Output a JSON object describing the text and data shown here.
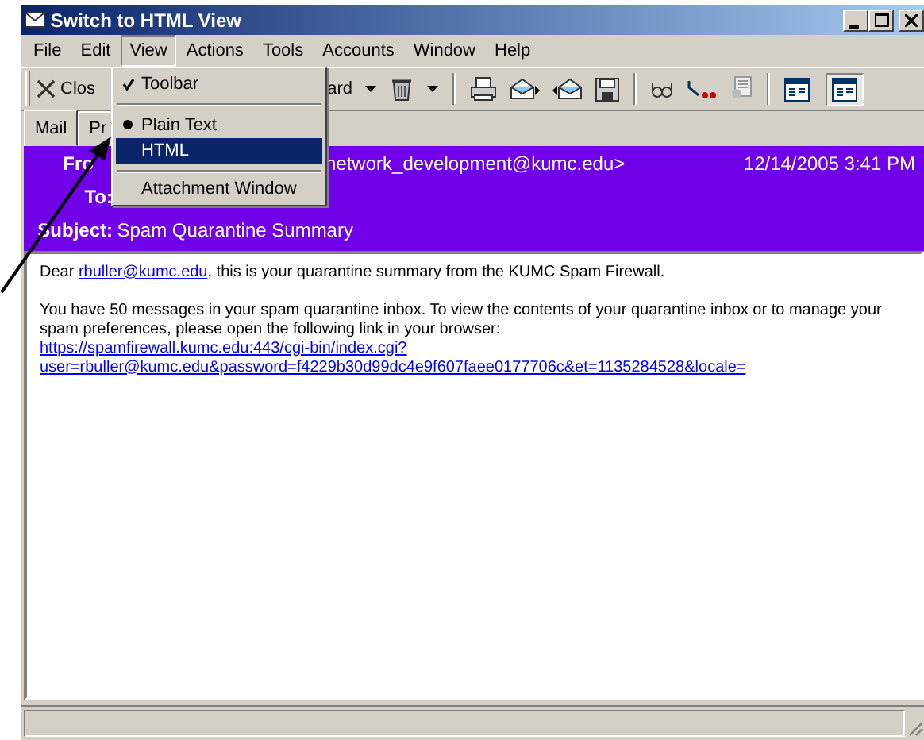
{
  "window": {
    "title": "Switch to HTML View"
  },
  "menu_bar": [
    {
      "label": "File",
      "selected": false
    },
    {
      "label": "Edit",
      "selected": false
    },
    {
      "label": "View",
      "selected": true
    },
    {
      "label": "Actions",
      "selected": false
    },
    {
      "label": "Tools",
      "selected": false
    },
    {
      "label": "Accounts",
      "selected": false
    },
    {
      "label": "Window",
      "selected": false
    },
    {
      "label": "Help",
      "selected": false
    }
  ],
  "view_menu": [
    {
      "kind": "check",
      "label": "Toolbar",
      "checked": true,
      "selected": false
    },
    {
      "kind": "separator"
    },
    {
      "kind": "radio",
      "label": "Plain Text",
      "checked": true,
      "selected": false
    },
    {
      "kind": "radio",
      "label": "HTML",
      "checked": false,
      "selected": true
    },
    {
      "kind": "separator"
    },
    {
      "kind": "item",
      "label": "Attachment Window",
      "selected": false
    }
  ],
  "toolbar": {
    "close_label": "Clos",
    "forward_label": "ard",
    "view_buttons": [
      {
        "selected": false
      },
      {
        "selected": true
      }
    ]
  },
  "tabs": [
    {
      "label": "Mail",
      "selected": true
    },
    {
      "label": "Pr",
      "selected": false
    }
  ],
  "header": {
    "from_label": "Fro",
    "from_value": "network_development@kumc.edu>",
    "date": "12/14/2005 3:41 PM",
    "to_label": "To:",
    "subject_label": "Subject:",
    "subject": "Spam Quarantine Summary"
  },
  "body": [
    [
      {
        "text": "Dear "
      },
      {
        "text": "rbuller@kumc.edu",
        "link": true
      },
      {
        "text": ", this is your quarantine summary from the KUMC Spam Firewall."
      }
    ],
    [
      {
        "text": "You have 50 messages in your spam quarantine inbox.  To view the contents of your quarantine inbox or to manage your spam preferences, please open the following link in your browser:"
      }
    ],
    [
      {
        "text": "https://spamfirewall.kumc.edu:443/cgi-bin/index.cgi?",
        "link": true
      }
    ],
    [
      {
        "text": "user=rbuller@kumc.edu&password=f4229b30d99dc4e9f607faee0177706c&et=1135284528&locale=",
        "link": true
      }
    ]
  ]
}
